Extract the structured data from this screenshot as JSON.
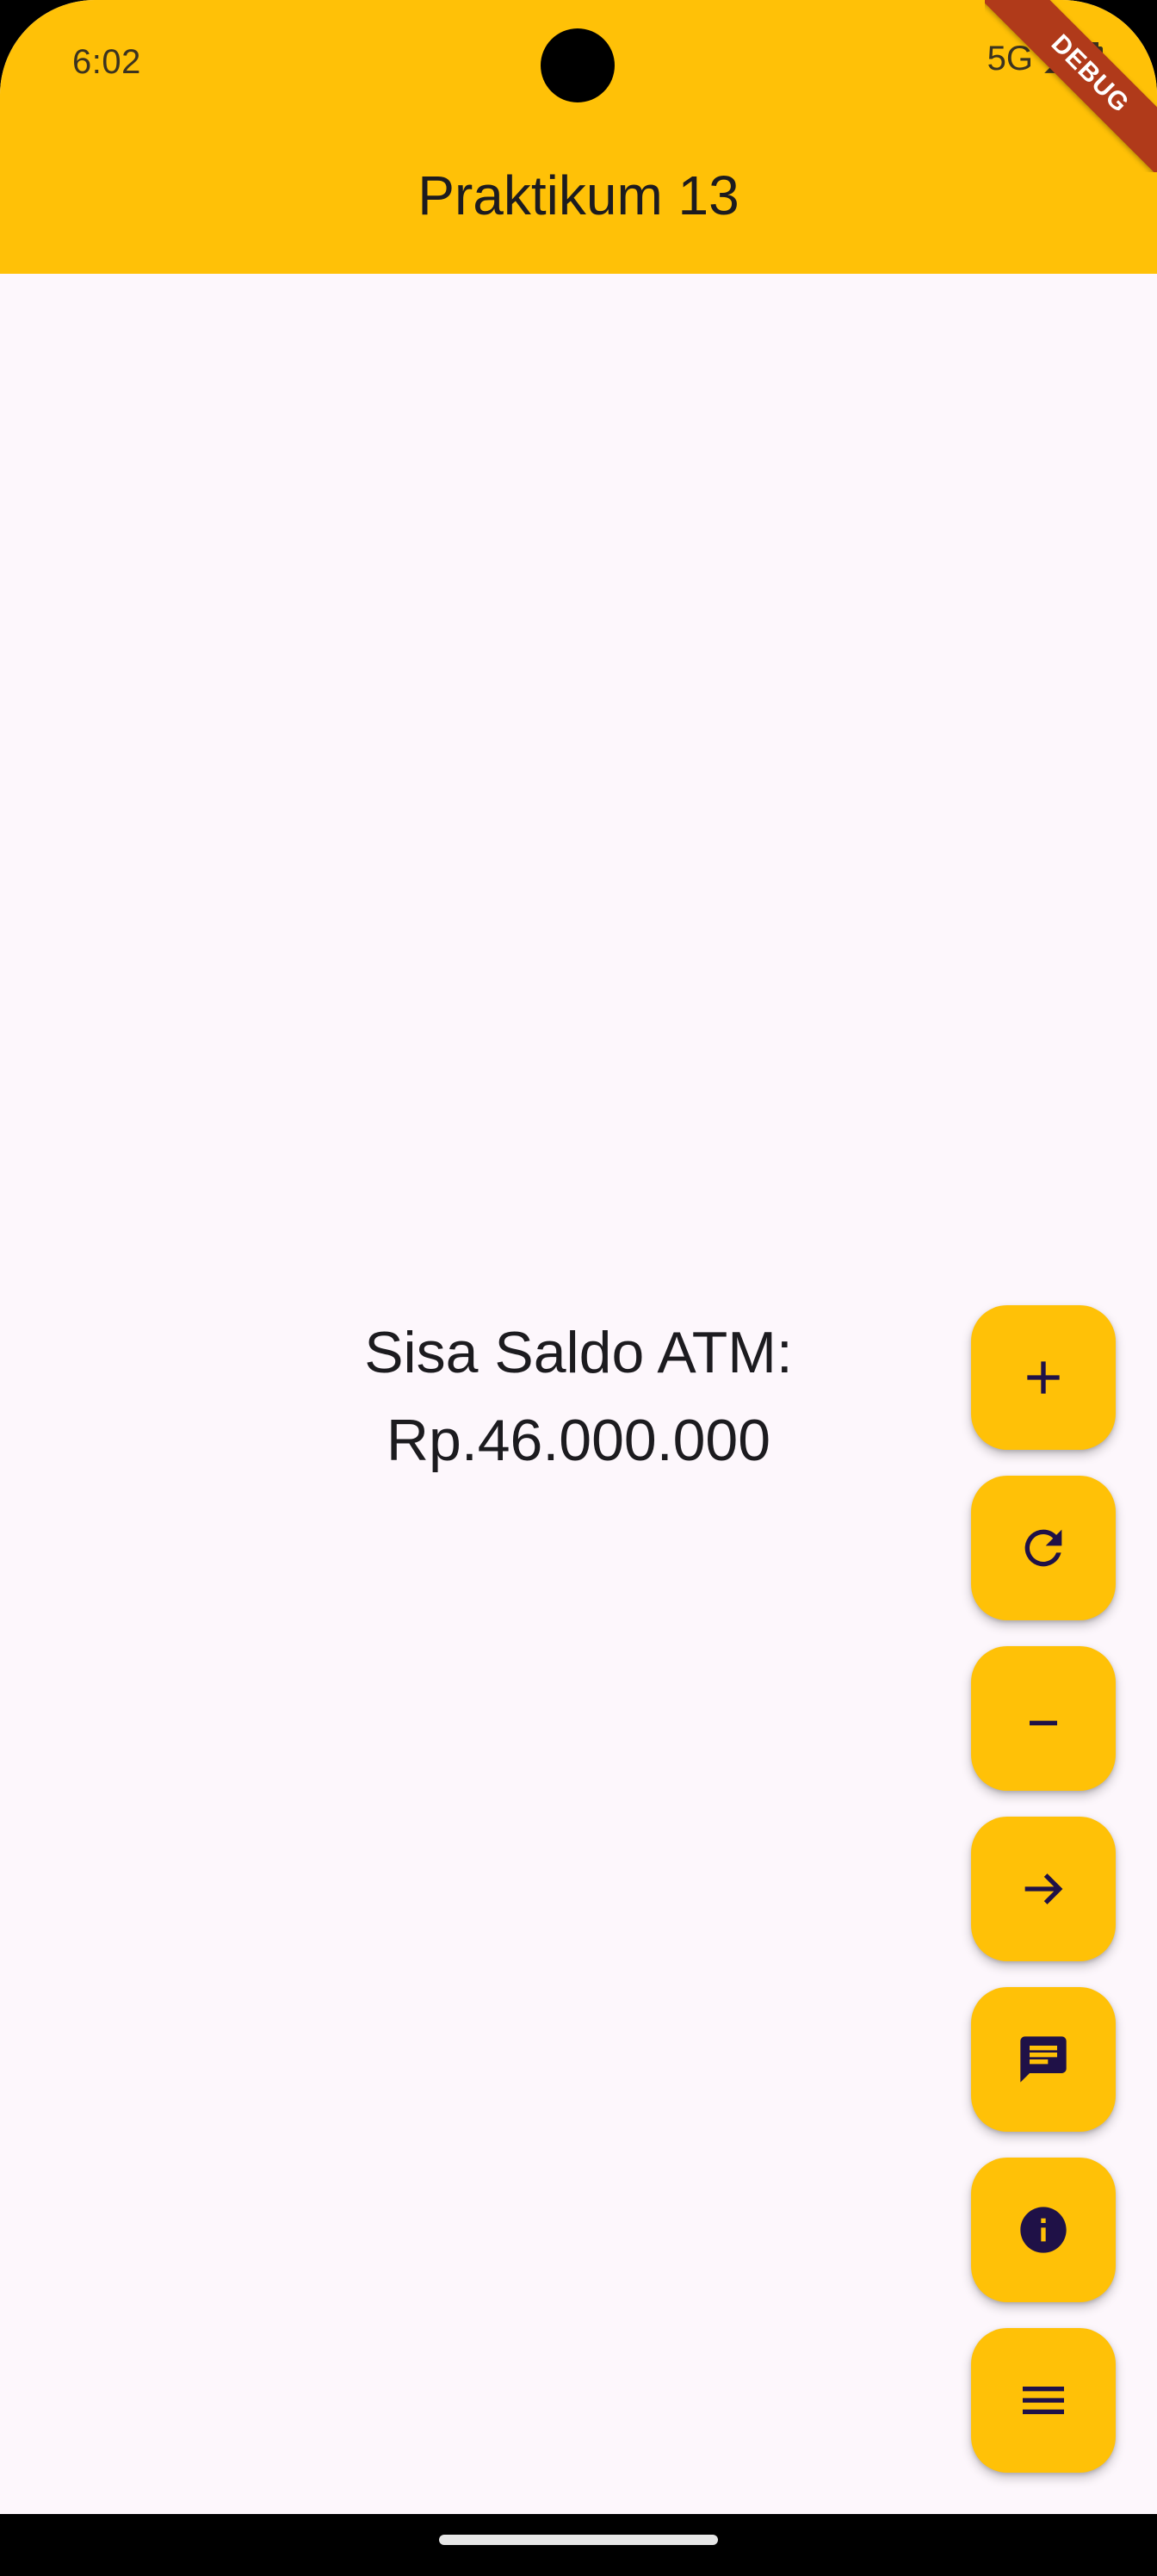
{
  "status_bar": {
    "time": "6:02",
    "network": "5G",
    "icons": [
      "signal-icon",
      "battery-icon"
    ]
  },
  "app_bar": {
    "title": "Praktikum 13",
    "color": "#FFC107"
  },
  "debug_banner": "DEBUG",
  "balance": {
    "label": "Sisa Saldo ATM:",
    "value": "Rp.46.000.000"
  },
  "fabs": [
    {
      "icon": "add-icon"
    },
    {
      "icon": "refresh-icon"
    },
    {
      "icon": "remove-icon"
    },
    {
      "icon": "arrow-forward-icon"
    },
    {
      "icon": "message-icon"
    },
    {
      "icon": "info-icon"
    },
    {
      "icon": "menu-icon"
    }
  ],
  "colors": {
    "accent": "#FFC107",
    "background": "#FDF7FC",
    "icon": "#1F1147"
  }
}
